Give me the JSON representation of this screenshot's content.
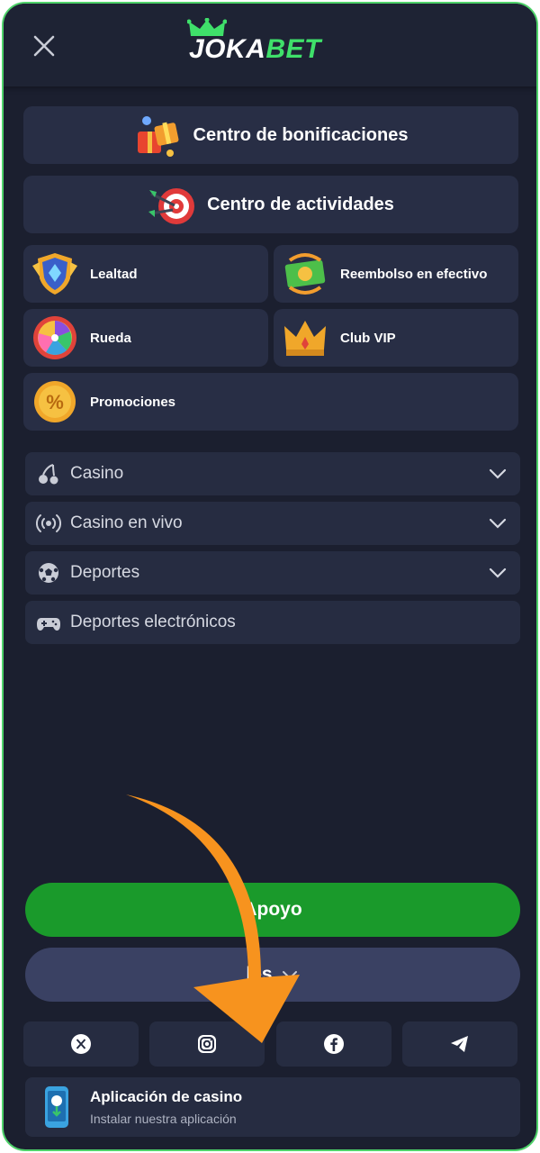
{
  "header": {
    "logo_part1": "JOKA",
    "logo_part2": "BET"
  },
  "promo_cards": {
    "bonus_center": "Centro de bonificaciones",
    "activity_center": "Centro de actividades",
    "loyalty": "Lealtad",
    "cashback": "Reembolso en efectivo",
    "wheel": "Rueda",
    "vip_club": "Club VIP",
    "promotions": "Promociones"
  },
  "menu": {
    "items": [
      {
        "label": "Casino",
        "icon": "cherry-icon",
        "expandable": true
      },
      {
        "label": "Casino en vivo",
        "icon": "broadcast-icon",
        "expandable": true
      },
      {
        "label": "Deportes",
        "icon": "soccer-ball-icon",
        "expandable": true
      },
      {
        "label": "Deportes electrónicos",
        "icon": "gamepad-icon",
        "expandable": false
      }
    ]
  },
  "buttons": {
    "support": "Apoyo",
    "language_partial": "lés"
  },
  "social": [
    "x-icon",
    "instagram-icon",
    "facebook-icon",
    "telegram-icon"
  ],
  "app_banner": {
    "title": "Aplicación de casino",
    "subtitle": "Instalar nuestra aplicación"
  },
  "colors": {
    "background": "#1b1f2f",
    "card": "#282e45",
    "accent_green": "#1a9a2b",
    "logo_green": "#3fe06a",
    "arrow_orange": "#f7931e"
  }
}
